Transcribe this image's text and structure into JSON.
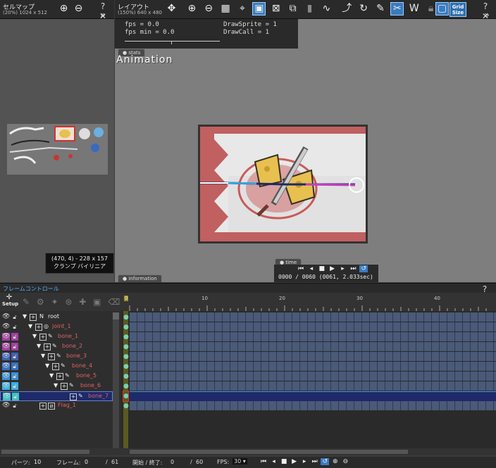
{
  "cellmap": {
    "title": "セルマップ",
    "subtitle": "(20%) 1024 x 512",
    "readout_line1": "(470, 4) - 228 x 157",
    "readout_line2": "クランプ バイリニア"
  },
  "layout": {
    "title": "レイアウト",
    "subtitle": "(150%) 640 x 480",
    "grid_label_1": "Grid",
    "grid_label_2": "Size"
  },
  "stats": {
    "fps": "fps = 0.0",
    "fps_min": "fps min = 0.0",
    "draw_sprite": "DrawSprite = 1",
    "draw_call": "DrawCall = 1",
    "tab": "stats"
  },
  "canvas": {
    "anim_label": "Animation",
    "info_tab": "information"
  },
  "time": {
    "tab": "time",
    "readout": "0000 / 0060 (0061, 2.033sec)"
  },
  "frame_control": {
    "title": "フレームコントロール",
    "setup_label": "Setup",
    "help": "?",
    "close": "✕"
  },
  "ruler": {
    "ticks": [
      "0",
      "10",
      "20",
      "30",
      "40"
    ]
  },
  "layers": [
    {
      "name": "root",
      "color": "#eeeeee"
    },
    {
      "name": "joint_1",
      "color": "#e06060"
    },
    {
      "name": "bone_1",
      "color": "#e06060"
    },
    {
      "name": "bone_2",
      "color": "#e06060"
    },
    {
      "name": "bone_3",
      "color": "#e06060"
    },
    {
      "name": "bone_4",
      "color": "#e06060"
    },
    {
      "name": "bone_5",
      "color": "#e06060"
    },
    {
      "name": "bone_6",
      "color": "#e06060"
    },
    {
      "name": "bone_7",
      "color": "#e06060"
    },
    {
      "name": "Flag_1",
      "color": "#e06060"
    }
  ],
  "status": {
    "parts_label": "パーツ:",
    "parts_value": "10",
    "frame_label": "フレーム:",
    "frame_value": "0",
    "frame_total": "61",
    "range_label": "開始 / 終了:",
    "range_start": "0",
    "range_end": "60",
    "fps_label": "FPS:",
    "fps_value": "30"
  },
  "colors": {
    "accent": "#3a7bc0",
    "layer_name": "#e06060",
    "track": "#4a5a78"
  }
}
